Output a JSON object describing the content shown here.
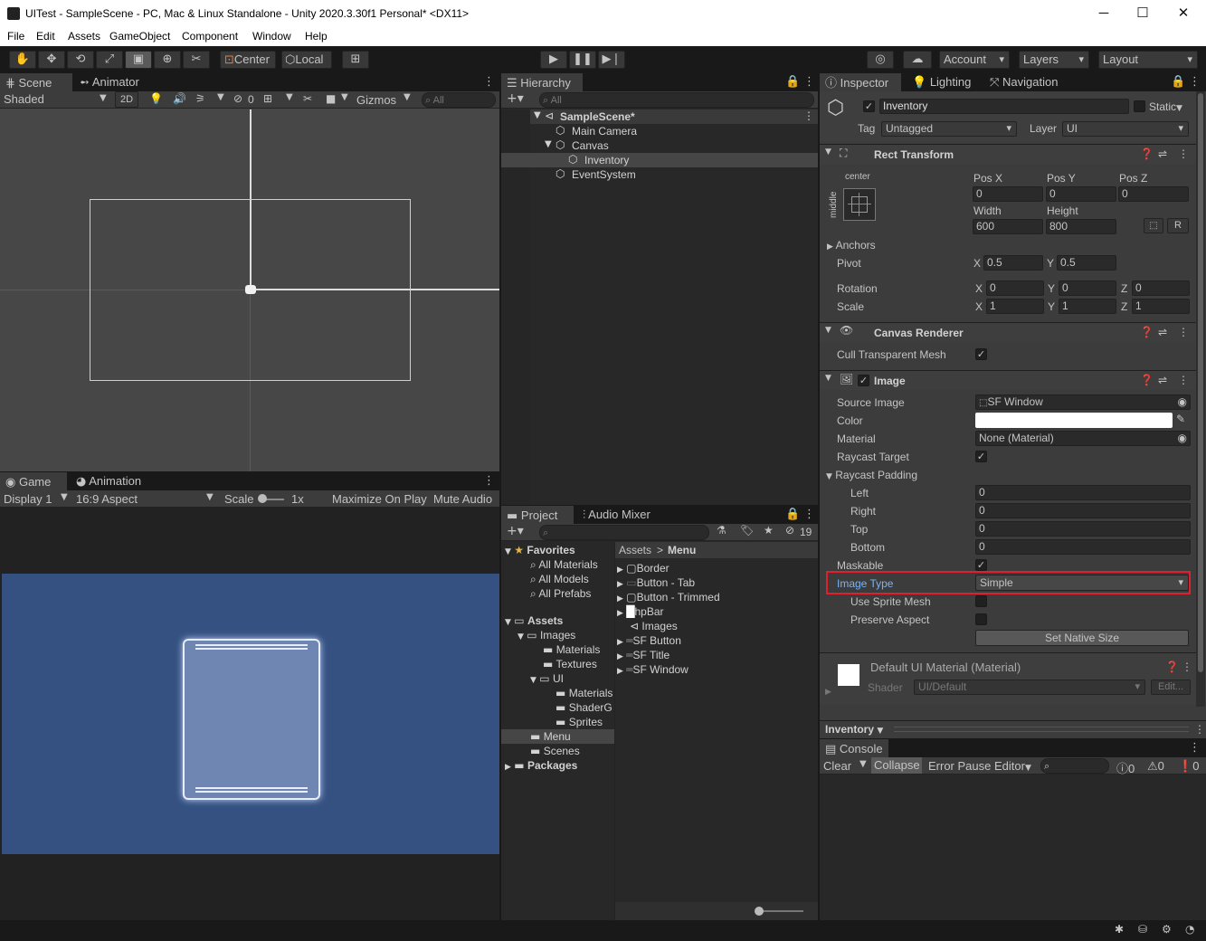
{
  "window": {
    "title": "UITest - SampleScene - PC, Mac & Linux Standalone - Unity 2020.3.30f1 Personal* <DX11>",
    "minimize": "─",
    "maximize": "☐",
    "close": "✕"
  },
  "menu": [
    "File",
    "Edit",
    "Assets",
    "GameObject",
    "Component",
    "Window",
    "Help"
  ],
  "toolbar": {
    "pivot_center": "Center",
    "pivot_local": "Local",
    "account": "Account",
    "layers": "Layers",
    "layout": "Layout"
  },
  "scene": {
    "tab_scene": "Scene",
    "tab_animator": "Animator",
    "shading": "Shaded",
    "mode_2d": "2D",
    "hidden_count": "0",
    "gizmos": "Gizmos",
    "search_placeholder": "All"
  },
  "game": {
    "tab_game": "Game",
    "tab_animation": "Animation",
    "display": "Display 1",
    "aspect": "16:9 Aspect",
    "scale_label": "Scale",
    "scale_value": "1x",
    "maximize": "Maximize On Play",
    "mute": "Mute Audio"
  },
  "hierarchy": {
    "tab": "Hierarchy",
    "search_placeholder": "All",
    "items": [
      "SampleScene*",
      "Main Camera",
      "Canvas",
      "Inventory",
      "EventSystem"
    ]
  },
  "project": {
    "tab_project": "Project",
    "tab_audio": "Audio Mixer",
    "hidden_count": "19",
    "favorites": "Favorites",
    "fav_items": [
      "All Materials",
      "All Models",
      "All Prefabs"
    ],
    "assets": "Assets",
    "images": "Images",
    "materials": "Materials",
    "textures": "Textures",
    "ui": "UI",
    "ui_materials": "Materials",
    "ui_shaders": "ShaderG",
    "ui_sprites": "Sprites",
    "menu": "Menu",
    "scenes": "Scenes",
    "packages": "Packages",
    "breadcrumb_root": "Assets",
    "breadcrumb_sep": ">",
    "breadcrumb_leaf": "Menu",
    "files": [
      "Border",
      "Button - Tab",
      "Button - Trimmed",
      "hpBar",
      "Images",
      "SF Button",
      "SF Title",
      "SF Window"
    ]
  },
  "inspector": {
    "tab_inspector": "Inspector",
    "tab_lighting": "Lighting",
    "tab_navigation": "Navigation",
    "object_name": "Inventory",
    "static": "Static",
    "tag_label": "Tag",
    "tag_value": "Untagged",
    "layer_label": "Layer",
    "layer_value": "UI",
    "rect": {
      "title": "Rect Transform",
      "anchor_h": "center",
      "anchor_v": "middle",
      "posx_label": "Pos X",
      "posx": "0",
      "posy_label": "Pos Y",
      "posy": "0",
      "posz_label": "Pos Z",
      "posz": "0",
      "width_label": "Width",
      "width": "600",
      "height_label": "Height",
      "height": "800",
      "r_button": "R",
      "anchors": "Anchors",
      "pivot": "Pivot",
      "pivot_x": "0.5",
      "pivot_y": "0.5",
      "rotation": "Rotation",
      "rot_x": "0",
      "rot_y": "0",
      "rot_z": "0",
      "scale": "Scale",
      "scale_x": "1",
      "scale_y": "1",
      "scale_z": "1",
      "x": "X",
      "y": "Y",
      "z": "Z"
    },
    "canvas_renderer": {
      "title": "Canvas Renderer",
      "cull": "Cull Transparent Mesh"
    },
    "image": {
      "title": "Image",
      "source_label": "Source Image",
      "source_value": "SF Window",
      "color_label": "Color",
      "material_label": "Material",
      "material_value": "None (Material)",
      "raycast_label": "Raycast Target",
      "padding_label": "Raycast Padding",
      "left_label": "Left",
      "left": "0",
      "right_label": "Right",
      "right": "0",
      "top_label": "Top",
      "top": "0",
      "bottom_label": "Bottom",
      "bottom": "0",
      "maskable_label": "Maskable",
      "image_type_label": "Image Type",
      "image_type_value": "Simple",
      "sprite_mesh_label": "Use Sprite Mesh",
      "preserve_label": "Preserve Aspect",
      "native_size": "Set Native Size"
    },
    "material": {
      "title": "Default UI Material (Material)",
      "shader_label": "Shader",
      "shader_value": "UI/Default",
      "edit": "Edit..."
    },
    "preview_label": "Inventory",
    "colors": {
      "highlight": "#e0202a",
      "selected_label": "#7ab3f5"
    }
  },
  "console": {
    "tab": "Console",
    "clear": "Clear",
    "collapse": "Collapse",
    "error_pause": "Error Pause",
    "editor": "Editor",
    "logs": "0",
    "warnings": "0",
    "errors": "0"
  }
}
